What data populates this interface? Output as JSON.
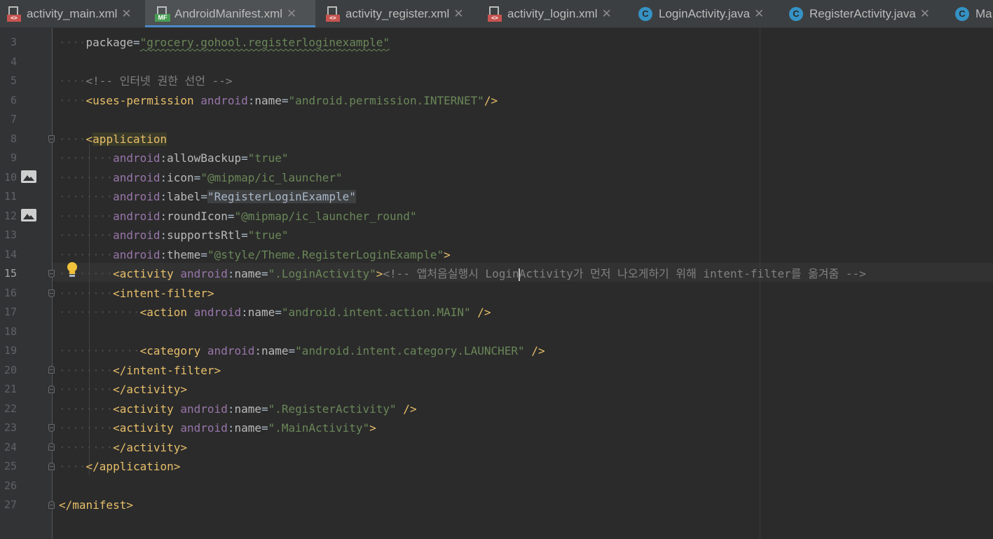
{
  "tabs": [
    {
      "label": "activity_main.xml",
      "type": "xml",
      "active": false
    },
    {
      "label": "AndroidManifest.xml",
      "type": "manifest",
      "active": true
    },
    {
      "label": "activity_register.xml",
      "type": "xml",
      "active": false
    },
    {
      "label": "activity_login.xml",
      "type": "xml",
      "active": false
    },
    {
      "label": "LoginActivity.java",
      "type": "class",
      "active": false
    },
    {
      "label": "RegisterActivity.java",
      "type": "class",
      "active": false
    },
    {
      "label": "Ma",
      "type": "class",
      "active": false
    }
  ],
  "icons": {
    "xml_badge": "<>",
    "manifest_badge": "MF",
    "class_letter": "C",
    "close": "✕"
  },
  "current_line": 15,
  "lines": [
    {
      "n": "3",
      "indent": 1,
      "tokens": [
        [
          "attr",
          "package"
        ],
        [
          "plain",
          "="
        ],
        [
          "val",
          "\"grocery.gohool.registerloginexample\""
        ]
      ]
    },
    {
      "n": "4",
      "indent": 0,
      "tokens": []
    },
    {
      "n": "5",
      "indent": 1,
      "tokens": [
        [
          "cmt",
          "<!-- 인터넷 권한 선언 -->"
        ]
      ]
    },
    {
      "n": "6",
      "indent": 1,
      "tokens": [
        [
          "tag",
          "<uses-permission "
        ],
        [
          "ns",
          "android"
        ],
        [
          "plain",
          ":"
        ],
        [
          "attr",
          "name"
        ],
        [
          "plain",
          "="
        ],
        [
          "val",
          "\"android.permission.INTERNET\""
        ],
        [
          "tag",
          "/>"
        ]
      ]
    },
    {
      "n": "7",
      "indent": 0,
      "tokens": []
    },
    {
      "n": "8",
      "indent": 1,
      "tokens": [
        [
          "tag",
          "<"
        ],
        [
          "tag",
          "application"
        ]
      ]
    },
    {
      "n": "9",
      "indent": 2,
      "tokens": [
        [
          "ns",
          "android"
        ],
        [
          "plain",
          ":"
        ],
        [
          "attr",
          "allowBackup"
        ],
        [
          "plain",
          "="
        ],
        [
          "val",
          "\"true\""
        ]
      ]
    },
    {
      "n": "10",
      "indent": 2,
      "tokens": [
        [
          "ns",
          "android"
        ],
        [
          "plain",
          ":"
        ],
        [
          "attr",
          "icon"
        ],
        [
          "plain",
          "="
        ],
        [
          "val",
          "\"@mipmap/ic_launcher\""
        ]
      ]
    },
    {
      "n": "11",
      "indent": 2,
      "tokens": [
        [
          "ns",
          "android"
        ],
        [
          "plain",
          ":"
        ],
        [
          "attr",
          "label"
        ],
        [
          "plain",
          "="
        ],
        [
          "plain",
          "\"RegisterLoginExample\""
        ]
      ]
    },
    {
      "n": "12",
      "indent": 2,
      "tokens": [
        [
          "ns",
          "android"
        ],
        [
          "plain",
          ":"
        ],
        [
          "attr",
          "roundIcon"
        ],
        [
          "plain",
          "="
        ],
        [
          "val",
          "\"@mipmap/ic_launcher_round\""
        ]
      ]
    },
    {
      "n": "13",
      "indent": 2,
      "tokens": [
        [
          "ns",
          "android"
        ],
        [
          "plain",
          ":"
        ],
        [
          "attr",
          "supportsRtl"
        ],
        [
          "plain",
          "="
        ],
        [
          "val",
          "\"true\""
        ]
      ]
    },
    {
      "n": "14",
      "indent": 2,
      "tokens": [
        [
          "ns",
          "android"
        ],
        [
          "plain",
          ":"
        ],
        [
          "attr",
          "theme"
        ],
        [
          "plain",
          "="
        ],
        [
          "val",
          "\"@style/Theme.RegisterLoginExample\""
        ],
        [
          "tag",
          ">"
        ]
      ]
    },
    {
      "n": "15",
      "indent": 2,
      "tokens": [
        [
          "tag",
          "<activity "
        ],
        [
          "ns",
          "android"
        ],
        [
          "plain",
          ":"
        ],
        [
          "attr",
          "name"
        ],
        [
          "plain",
          "="
        ],
        [
          "val",
          "\".LoginActivity\""
        ],
        [
          "tag",
          ">"
        ],
        [
          "cmt",
          "<!-- 앱처음실행시 Login"
        ],
        [
          "cmt",
          "Activity가 먼저 나오게하기 위해 intent-filter를 옮겨줌 -->"
        ]
      ]
    },
    {
      "n": "16",
      "indent": 2,
      "tokens": [
        [
          "tag",
          "<intent-filter>"
        ]
      ]
    },
    {
      "n": "17",
      "indent": 3,
      "tokens": [
        [
          "tag",
          "<action "
        ],
        [
          "ns",
          "android"
        ],
        [
          "plain",
          ":"
        ],
        [
          "attr",
          "name"
        ],
        [
          "plain",
          "="
        ],
        [
          "val",
          "\"android.intent.action.MAIN\""
        ],
        [
          "tag",
          " />"
        ]
      ]
    },
    {
      "n": "18",
      "indent": 0,
      "tokens": []
    },
    {
      "n": "19",
      "indent": 3,
      "tokens": [
        [
          "tag",
          "<category "
        ],
        [
          "ns",
          "android"
        ],
        [
          "plain",
          ":"
        ],
        [
          "attr",
          "name"
        ],
        [
          "plain",
          "="
        ],
        [
          "val",
          "\"android.intent.category.LAUNCHER\""
        ],
        [
          "tag",
          " />"
        ]
      ]
    },
    {
      "n": "20",
      "indent": 2,
      "tokens": [
        [
          "tag",
          "</intent-filter>"
        ]
      ]
    },
    {
      "n": "21",
      "indent": 2,
      "tokens": [
        [
          "tag",
          "</activity>"
        ]
      ]
    },
    {
      "n": "22",
      "indent": 2,
      "tokens": [
        [
          "tag",
          "<activity "
        ],
        [
          "ns",
          "android"
        ],
        [
          "plain",
          ":"
        ],
        [
          "attr",
          "name"
        ],
        [
          "plain",
          "="
        ],
        [
          "val",
          "\".RegisterActivity\""
        ],
        [
          "tag",
          " />"
        ]
      ]
    },
    {
      "n": "23",
      "indent": 2,
      "tokens": [
        [
          "tag",
          "<activity "
        ],
        [
          "ns",
          "android"
        ],
        [
          "plain",
          ":"
        ],
        [
          "attr",
          "name"
        ],
        [
          "plain",
          "="
        ],
        [
          "val",
          "\".MainActivity\""
        ],
        [
          "tag",
          ">"
        ]
      ]
    },
    {
      "n": "24",
      "indent": 2,
      "tokens": [
        [
          "tag",
          "</activity>"
        ]
      ]
    },
    {
      "n": "25",
      "indent": 1,
      "tokens": [
        [
          "tag",
          "</application>"
        ]
      ]
    },
    {
      "n": "26",
      "indent": 0,
      "tokens": []
    },
    {
      "n": "27",
      "indent": 0,
      "tokens": [
        [
          "tag",
          "</manifest>"
        ]
      ]
    }
  ]
}
